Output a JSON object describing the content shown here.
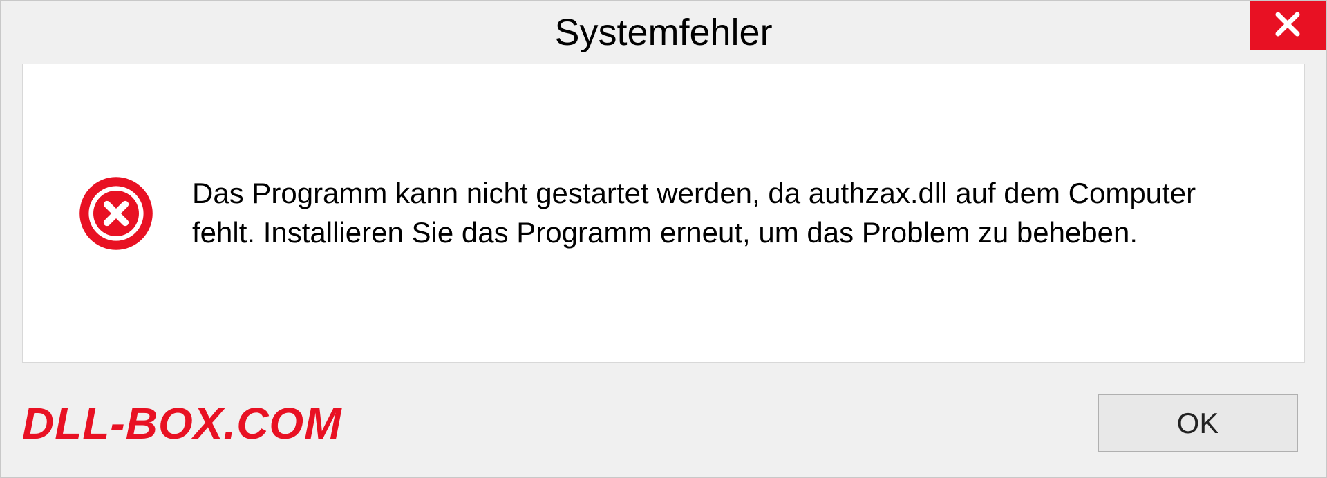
{
  "dialog": {
    "title": "Systemfehler",
    "message": "Das Programm kann nicht gestartet werden, da authzax.dll auf dem Computer fehlt. Installieren Sie das Programm erneut, um das Problem zu beheben.",
    "ok_label": "OK"
  },
  "watermark": "DLL-BOX.COM"
}
